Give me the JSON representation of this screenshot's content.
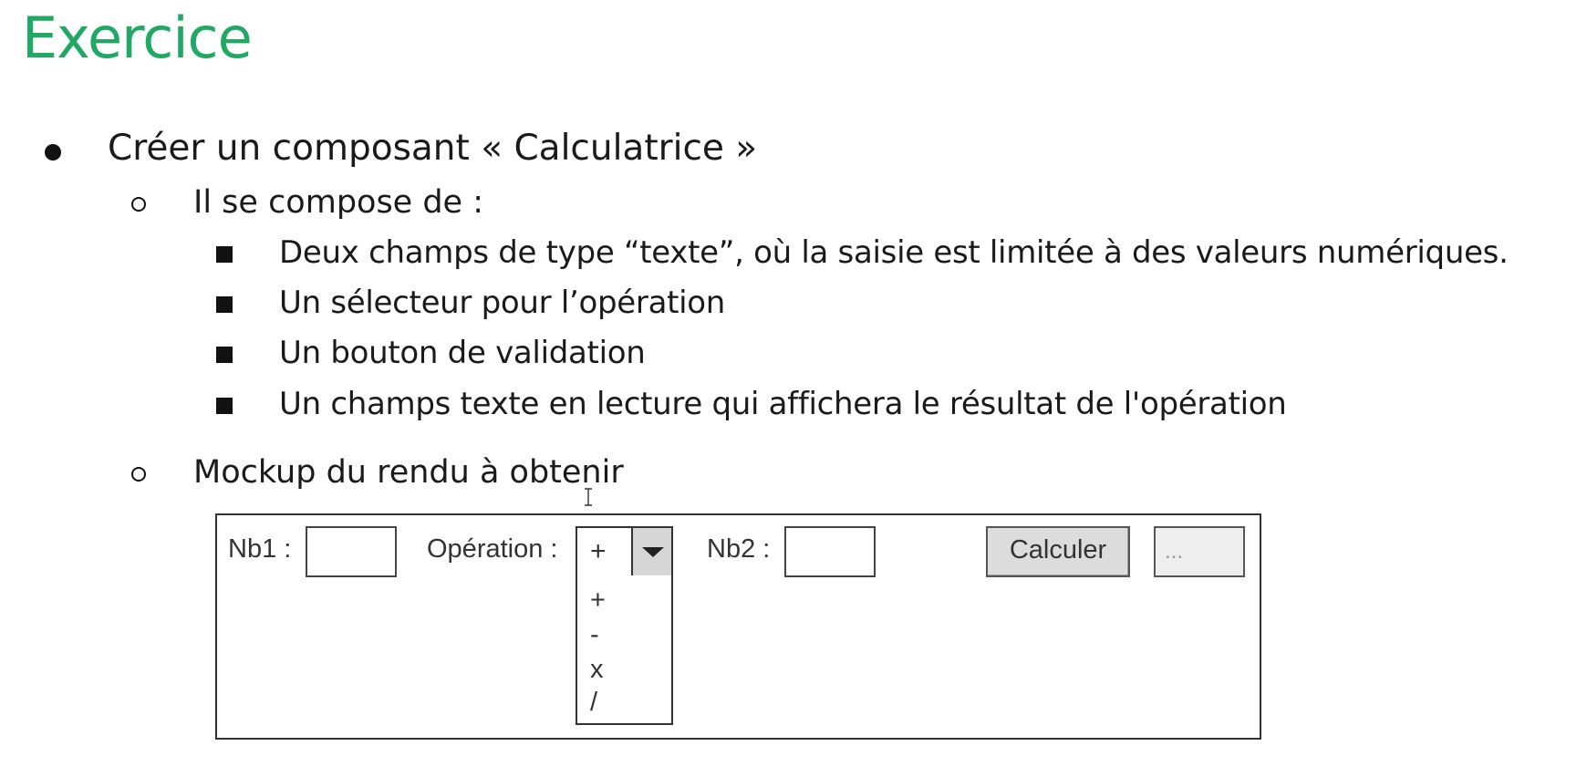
{
  "title": "Exercice",
  "bullets": {
    "level1": "Créer un composant « Calculatrice »",
    "compose": "Il se compose de :",
    "items": [
      "Deux champs de type “texte”, où la saisie est limitée à des valeurs numériques.",
      "Un sélecteur pour l’opération",
      "Un bouton de validation",
      "Un champs texte en lecture qui affichera le résultat de l'opération"
    ],
    "mockup_heading": "Mockup du rendu à obtenir"
  },
  "mockup": {
    "nb1_label": "Nb1 :",
    "operation_label": "Opération :",
    "operation_selected": "+",
    "operation_options": [
      "+",
      "-",
      "x",
      "/"
    ],
    "nb2_label": "Nb2 :",
    "calculate_button": "Calculer",
    "result_placeholder": "..."
  },
  "colors": {
    "title": "#22a865"
  }
}
